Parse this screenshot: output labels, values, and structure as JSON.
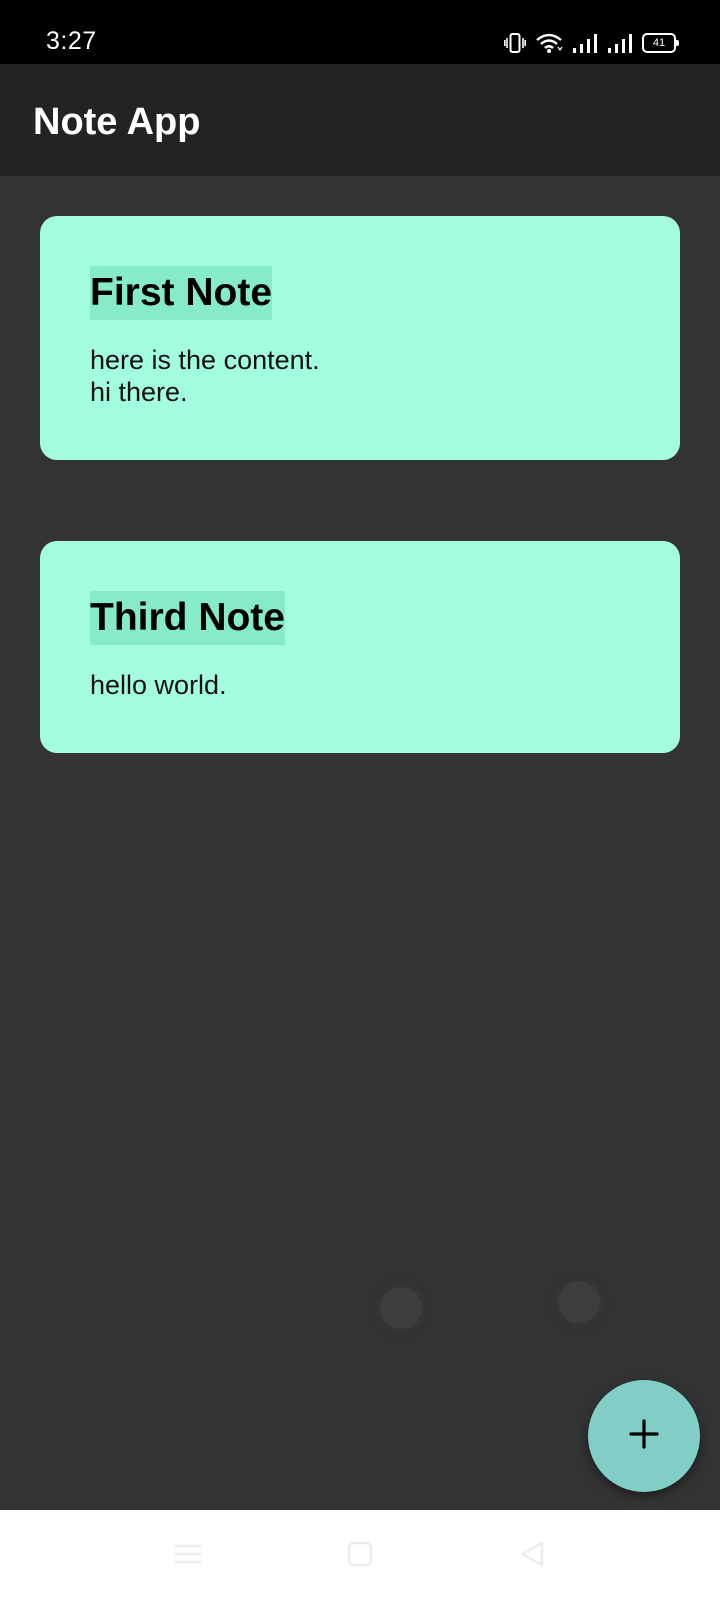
{
  "status_bar": {
    "time": "3:27",
    "battery_level": "41",
    "icons": [
      "vibrate-icon",
      "wifi-icon",
      "signal-icon",
      "signal-icon",
      "battery-icon"
    ]
  },
  "app_bar": {
    "title": "Note App"
  },
  "notes": [
    {
      "title": "First Note",
      "content": "here is the content.\nhi there."
    },
    {
      "title": "Third Note",
      "content": "hello world."
    }
  ],
  "fab": {
    "icon": "plus-icon"
  },
  "nav_bar": {
    "icons": [
      "menu-icon",
      "home-icon",
      "back-icon"
    ]
  },
  "colors": {
    "card_bg": "#a3fedf",
    "title_highlight": "#85ebca",
    "fab_bg": "#81cec6",
    "app_bar_bg": "#232323",
    "content_bg": "#333333"
  }
}
